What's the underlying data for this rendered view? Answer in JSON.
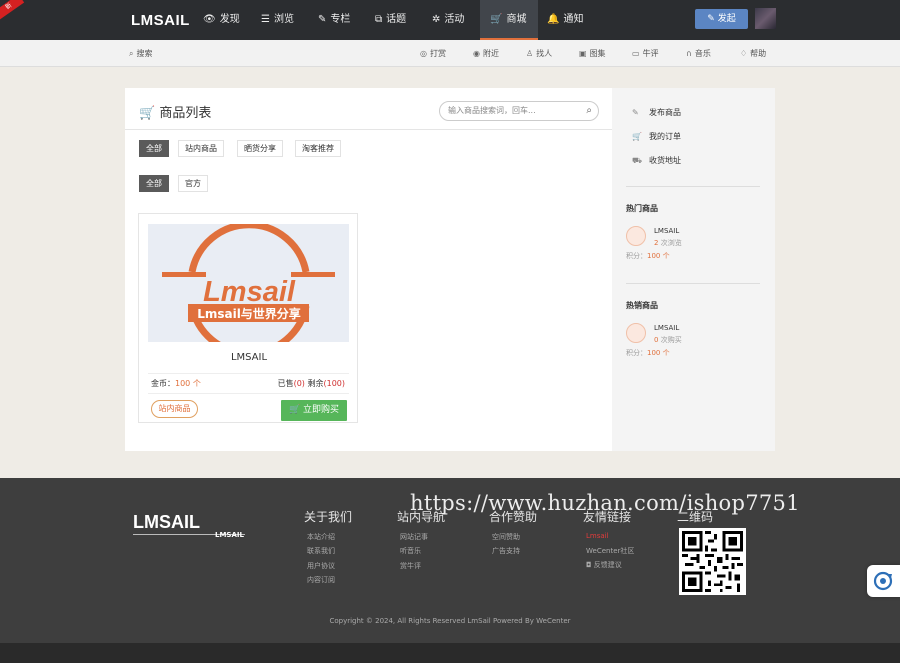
{
  "header": {
    "ribbon": "新",
    "logo": "LMSAIL",
    "nav": [
      {
        "label": "发现",
        "icon": "eye-icon"
      },
      {
        "label": "浏览",
        "icon": "list-icon"
      },
      {
        "label": "专栏",
        "icon": "feather-icon"
      },
      {
        "label": "话题",
        "icon": "tag-icon"
      },
      {
        "label": "活动",
        "icon": "activity-icon"
      },
      {
        "label": "商城",
        "icon": "cart-icon",
        "active": true
      },
      {
        "label": "通知",
        "icon": "bell-icon"
      }
    ],
    "publish_label": "发起"
  },
  "subnav": {
    "search_label": "搜索",
    "items": [
      {
        "label": "打赏",
        "icon": "reward-icon"
      },
      {
        "label": "附近",
        "icon": "location-icon"
      },
      {
        "label": "找人",
        "icon": "user-icon"
      },
      {
        "label": "图集",
        "icon": "image-icon"
      },
      {
        "label": "牛评",
        "icon": "comment-icon"
      },
      {
        "label": "音乐",
        "icon": "headphones-icon"
      },
      {
        "label": "帮助",
        "icon": "lightbulb-icon"
      }
    ]
  },
  "main": {
    "title": "商品列表",
    "search_placeholder": "输入商品搜索词，回车...",
    "filter_row1": [
      "全部",
      "站内商品",
      "晒货分享",
      "淘客推荐"
    ],
    "filter_row2": [
      "全部",
      "官方"
    ],
    "product": {
      "image_logo_text": "Lmsail",
      "image_banner_text": "Lmsail与世界分享",
      "name": "LMSAIL",
      "price_label": "金币：",
      "price_value": "100 个",
      "sold_label": "已售",
      "sold_value": "(0)",
      "remain_label": " 剩余",
      "remain_value": "(100)",
      "badge": "站内商品",
      "buy_label": "立即购买"
    }
  },
  "sidebar": {
    "links": [
      "发布商品",
      "我的订单",
      "收货地址"
    ],
    "hot_title": "热门商品",
    "hot_item": {
      "name": "LMSAIL",
      "count": "2",
      "count_label": " 次浏览",
      "points_label": "积分：",
      "points_value": "100 个"
    },
    "sale_title": "热销商品",
    "sale_item": {
      "name": "LMSAIL",
      "count": "0",
      "count_label": " 次购买",
      "points_label": "积分：",
      "points_value": "100 个"
    }
  },
  "footer": {
    "logo": "LMSAIL",
    "logo_small": "LMSAIL",
    "watermark": "https://www.huzhan.com/ishop7751",
    "columns": [
      {
        "title": "关于我们",
        "links": [
          "本站介绍",
          "联系我们",
          "用户协议",
          "内容订阅"
        ]
      },
      {
        "title": "站内导航",
        "links": [
          "网站记事",
          "听音乐",
          "赏牛评"
        ]
      },
      {
        "title": "合作赞助",
        "links": [
          "空间赞助",
          "广告支持"
        ]
      },
      {
        "title": "友情链接",
        "links": [
          "Lmsail",
          "WeCenter社区",
          "反馈建议"
        ]
      }
    ],
    "qr_title": "二维码",
    "copyright": "Copyright © 2024, All Rights Reserved LmSail Powered By WeCenter"
  },
  "colors": {
    "accent": "#e0703c",
    "buy": "#56b65a",
    "header": "#2b2d30",
    "publish": "#5b85c3"
  }
}
